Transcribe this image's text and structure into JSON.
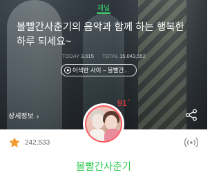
{
  "header": {
    "channel_label": "채널",
    "title": "볼빨간사춘기의 음악과 함께 하는 행복한 하루 되세요~",
    "today_label": "TODAY",
    "today_value": "3,615",
    "total_label": "TOTAL",
    "total_value": "15,043,552",
    "now_playing": "어색한 사이 – 볼빨간…",
    "detail_link": "상세정보"
  },
  "profile": {
    "temperature": "91",
    "temperature_unit": "°"
  },
  "footer": {
    "rating_count": "242,533",
    "channel_name": "볼빨간사춘기"
  },
  "colors": {
    "accent_green": "#2ec94f",
    "temperature_red": "#ff3b3b",
    "star_orange": "#f39a2d"
  },
  "icons": {
    "play": "play-circle-icon",
    "share": "share-icon",
    "star": "star-icon",
    "broadcast": "broadcast-icon",
    "chevron": "chevron-right-icon"
  }
}
